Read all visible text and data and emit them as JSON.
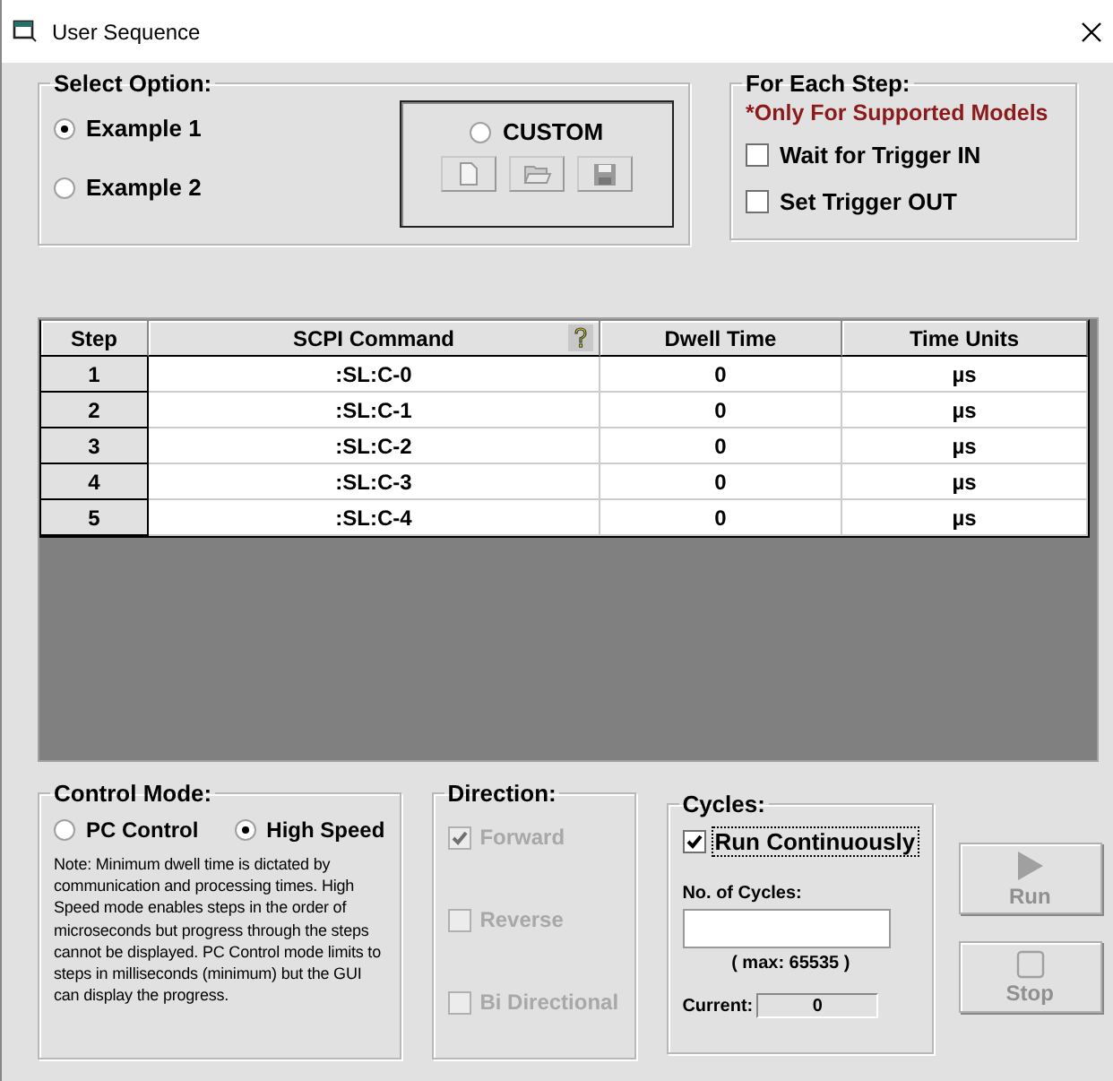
{
  "window": {
    "title": "User Sequence"
  },
  "select_option": {
    "legend": "Select Option:",
    "options": [
      {
        "label": "Example 1",
        "selected": true
      },
      {
        "label": "Example 2",
        "selected": false
      }
    ],
    "custom": {
      "label": "CUSTOM",
      "selected": false
    }
  },
  "for_each_step": {
    "legend": "For Each Step:",
    "note": "*Only For Supported Models",
    "checks": [
      {
        "label": "Wait for Trigger IN",
        "checked": false
      },
      {
        "label": "Set Trigger OUT",
        "checked": false
      }
    ]
  },
  "table": {
    "columns": [
      "Step",
      "SCPI Command",
      "Dwell Time",
      "Time Units"
    ],
    "rows": [
      {
        "step": "1",
        "command": ":SL:C-0",
        "dwell": "0",
        "units": "µs"
      },
      {
        "step": "2",
        "command": ":SL:C-1",
        "dwell": "0",
        "units": "µs"
      },
      {
        "step": "3",
        "command": ":SL:C-2",
        "dwell": "0",
        "units": "µs"
      },
      {
        "step": "4",
        "command": ":SL:C-3",
        "dwell": "0",
        "units": "µs"
      },
      {
        "step": "5",
        "command": ":SL:C-4",
        "dwell": "0",
        "units": "µs"
      }
    ]
  },
  "control_mode": {
    "legend": "Control Mode:",
    "options": [
      {
        "label": "PC Control",
        "selected": false
      },
      {
        "label": "High Speed",
        "selected": true
      }
    ],
    "note": "Note: Minimum dwell time is dictated by communication and processing times. High Speed mode enables steps in the order of microseconds but progress through the steps cannot be displayed. PC Control mode limits to steps in milliseconds (minimum) but the GUI can display the progress."
  },
  "direction": {
    "legend": "Direction:",
    "items": [
      {
        "label": "Forward",
        "checked": true,
        "disabled": true
      },
      {
        "label": "Reverse",
        "checked": false,
        "disabled": true
      },
      {
        "label": "Bi Directional",
        "checked": false,
        "disabled": true
      }
    ]
  },
  "cycles": {
    "legend": "Cycles:",
    "run_continuously": {
      "label": "Run Continuously",
      "checked": true
    },
    "count_label": "No. of Cycles:",
    "max": "( max: 65535 )",
    "current_label": "Current:",
    "current_value": "0"
  },
  "buttons": [
    {
      "label": "Run",
      "kind": "run",
      "disabled": true
    },
    {
      "label": "Stop",
      "kind": "stop",
      "disabled": true
    }
  ]
}
